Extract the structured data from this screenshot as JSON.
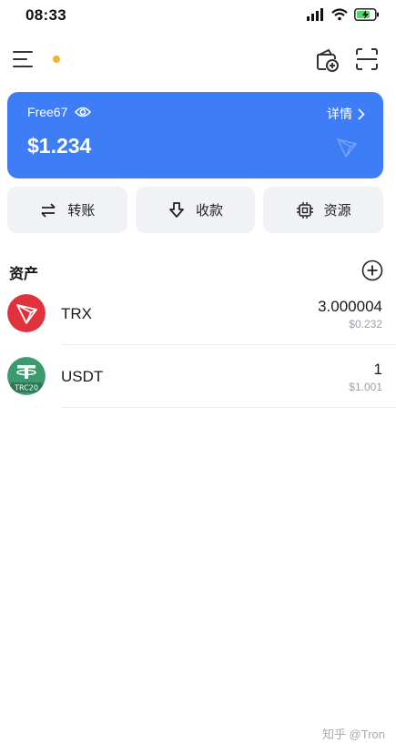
{
  "status_bar": {
    "time": "08:33"
  },
  "wallet": {
    "name": "Free67",
    "details_label": "详情",
    "balance": "$1.234"
  },
  "actions": [
    {
      "label": "转账",
      "icon": "transfer-icon"
    },
    {
      "label": "收款",
      "icon": "receive-icon"
    },
    {
      "label": "资源",
      "icon": "resource-chip-icon"
    }
  ],
  "assets": {
    "title": "资产",
    "items": [
      {
        "symbol": "TRX",
        "amount": "3.000004",
        "fiat": "$0.232",
        "logo_color": "#e0323d"
      },
      {
        "symbol": "USDT",
        "amount": "1",
        "fiat": "$1.001",
        "logo_color": "#3c9a6f",
        "badge": "TRC20"
      }
    ]
  },
  "watermark": "知乎 @Tron",
  "colors": {
    "accent": "#3d7df5",
    "dot": "#f0b52b"
  }
}
